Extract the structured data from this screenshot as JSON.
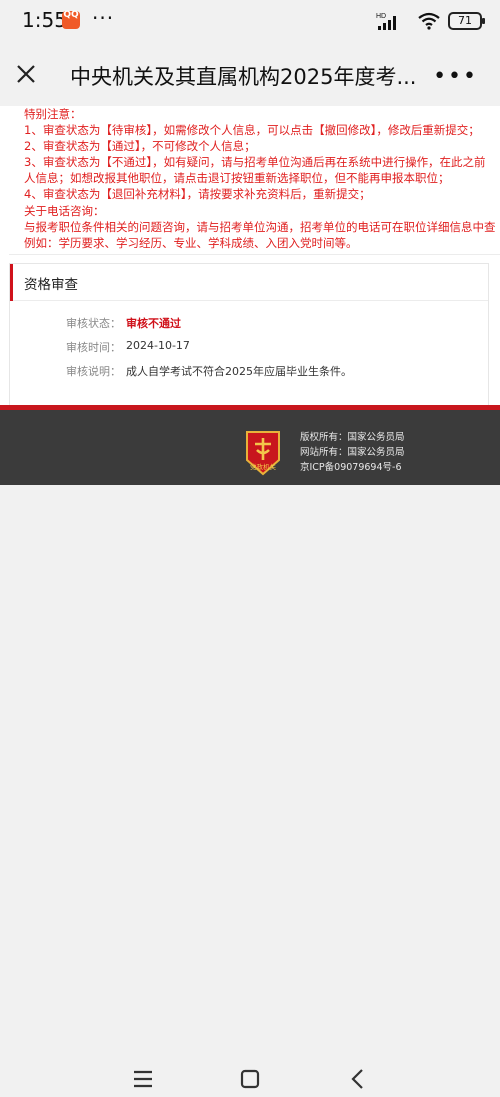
{
  "status_bar": {
    "time": "1:55",
    "app_icon_text": "QQ",
    "more": "···",
    "network": "HD",
    "battery": "71"
  },
  "title_bar": {
    "title": "中央机关及其直属机构2025年度考..."
  },
  "notice": {
    "lines": [
      "特别注意：",
      "1、审查状态为【待审核】，如需修改个人信息，可以点击【撤回修改】，修改后重新提交；",
      "2、审查状态为【通过】，不可修改个人信息；",
      "3、审查状态为【不通过】，如有疑问，请与招考单位沟通后再在系统中进行操作，在此之前",
      "人信息；如想改报其他职位，请点击退订按钮重新选择职位，但不能再申报本职位；",
      "4、审查状态为【退回补充材料】，请按要求补充资料后，重新提交；",
      "关于电话咨询：",
      "与报考职位条件相关的问题咨询，请与招考单位沟通，招考单位的电话可在职位详细信息中查",
      "例如：学历要求、学习经历、专业、学科成绩、入团入党时间等。"
    ]
  },
  "review": {
    "title": "资格审查",
    "status_label": "审核状态：",
    "status_value": "审核不通过",
    "time_label": "审核时间：",
    "time_value": "2024-10-17",
    "desc_label": "审核说明：",
    "desc_value": "成人自学考试不符合2025年应届毕业生条件。"
  },
  "footer": {
    "emblem_text": "党政机关",
    "copyright": "版权所有：国家公务员局",
    "site_owner": "网站所有：国家公务员局",
    "icp": "京ICP备09079694号-6"
  },
  "colors": {
    "accent_red": "#d0121b",
    "notice_red": "#e02020",
    "footer_bg": "#3b3b3b"
  }
}
